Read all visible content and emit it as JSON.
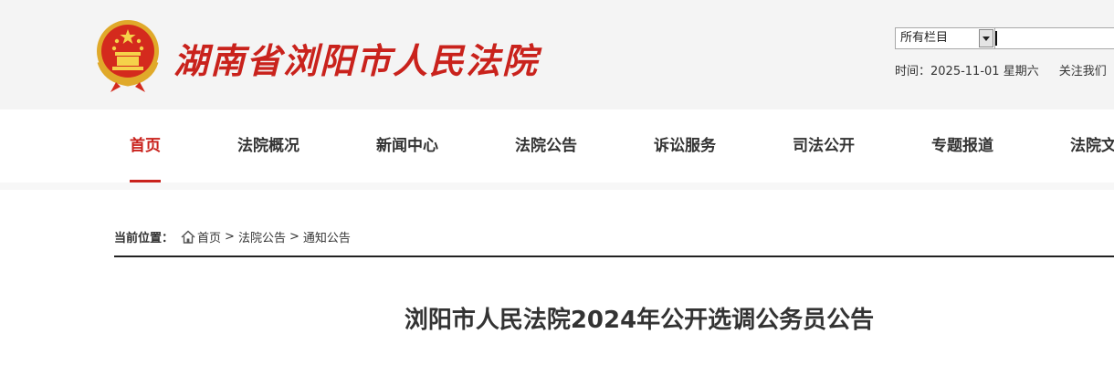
{
  "header": {
    "site_title": "湖南省浏阳市人民法院",
    "emblem_icon": "national-emblem-icon",
    "search": {
      "scope_selected": "所有栏目",
      "query_value": ""
    },
    "date_label": "时间：",
    "date_value": "2025-11-01 星期六",
    "follow_label": "关注我们"
  },
  "nav": {
    "items": [
      {
        "label": "首页",
        "active": true
      },
      {
        "label": "法院概况",
        "active": false
      },
      {
        "label": "新闻中心",
        "active": false
      },
      {
        "label": "法院公告",
        "active": false
      },
      {
        "label": "诉讼服务",
        "active": false
      },
      {
        "label": "司法公开",
        "active": false
      },
      {
        "label": "专题报道",
        "active": false
      },
      {
        "label": "法院文化",
        "active": false
      }
    ]
  },
  "breadcrumb": {
    "label": "当前位置：",
    "home_icon": "home-icon",
    "items": [
      "首页",
      "法院公告",
      "通知公告"
    ],
    "separator": ">"
  },
  "article": {
    "title": "浏阳市人民法院2024年公开选调公务员公告"
  },
  "colors": {
    "accent": "#c9221c",
    "header_bg": "#f4f4f4",
    "text": "#333333"
  }
}
